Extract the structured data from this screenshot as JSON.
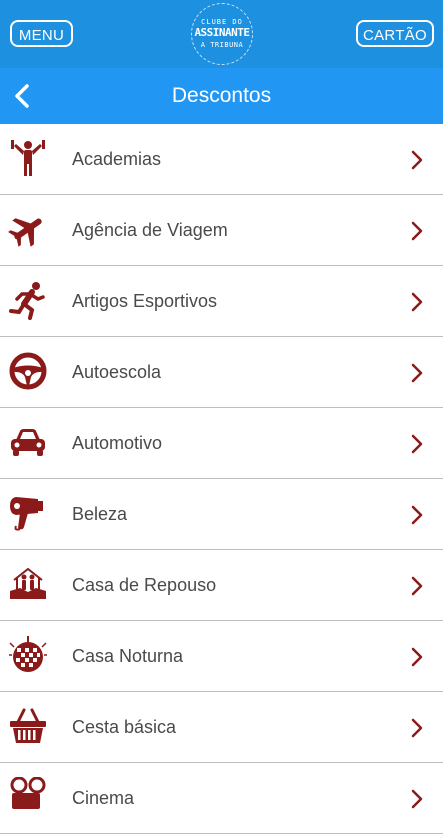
{
  "header": {
    "menu_label": "MENU",
    "card_label": "CARTÃO",
    "logo": {
      "top": "CLUBE DO",
      "middle": "ASSINANTE",
      "bottom": "A TRIBUNA"
    }
  },
  "subheader": {
    "title": "Descontos",
    "back_icon": "chevron-left-icon"
  },
  "colors": {
    "header": "#1e90e0",
    "subheader": "#2196f3",
    "icon": "#8b1a1a"
  },
  "categories": [
    {
      "label": "Academias",
      "icon": "gym-person-icon"
    },
    {
      "label": "Agência de Viagem",
      "icon": "airplane-icon"
    },
    {
      "label": "Artigos Esportivos",
      "icon": "running-person-icon"
    },
    {
      "label": "Autoescola",
      "icon": "steering-wheel-icon"
    },
    {
      "label": "Automotivo",
      "icon": "car-icon"
    },
    {
      "label": "Beleza",
      "icon": "hair-dryer-icon"
    },
    {
      "label": "Casa de Repouso",
      "icon": "elderly-home-icon"
    },
    {
      "label": "Casa Noturna",
      "icon": "disco-ball-icon"
    },
    {
      "label": "Cesta básica",
      "icon": "basket-icon"
    },
    {
      "label": "Cinema",
      "icon": "film-reel-icon"
    }
  ]
}
